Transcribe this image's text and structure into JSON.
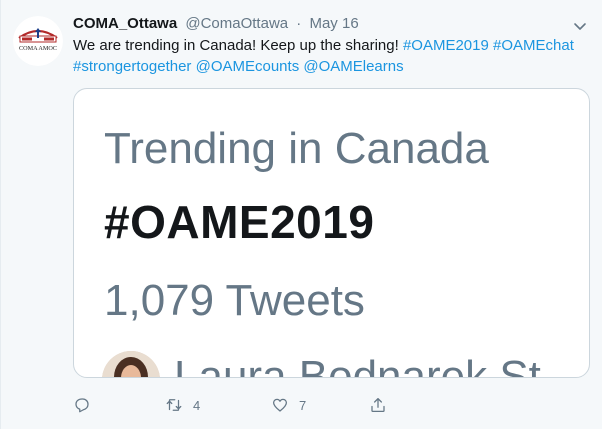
{
  "account": {
    "display_name": "COMA_Ottawa",
    "handle": "@ComaOttawa",
    "separator": "·",
    "date": "May 16",
    "avatar_text": "COMA AMOC"
  },
  "tweet": {
    "text": "We are trending in Canada! Keep up the sharing!",
    "entities": [
      "#OAME2019",
      "#OAMEchat",
      "#strongertogether",
      "@OAMEcounts",
      "@OAMElearns"
    ]
  },
  "media": {
    "heading": "Trending in Canada",
    "hashtag": "#OAME2019",
    "count": "1,079 Tweets",
    "user_name": "Laura Bodnarek  St"
  },
  "actions": {
    "reply_icon": "reply-icon",
    "retweet_icon": "retweet-icon",
    "retweet_count": "4",
    "like_icon": "heart-icon",
    "like_count": "7",
    "share_icon": "share-icon"
  },
  "colors": {
    "link": "#1b95e0",
    "secondary_text": "#657786",
    "primary_text": "#14171a",
    "background": "#f5f8fa"
  }
}
